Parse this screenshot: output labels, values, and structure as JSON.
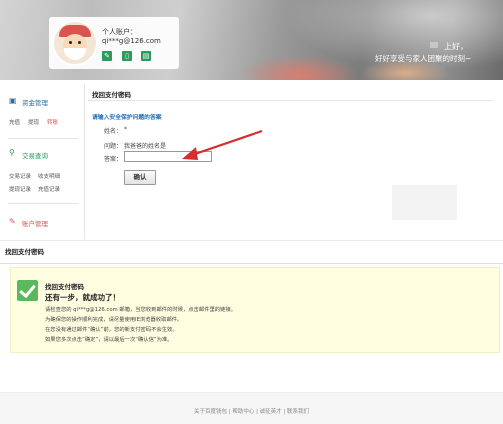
{
  "header": {
    "account_label": "个人账户：",
    "account_email": "qi***g@126.com",
    "greeting_line1": "上好，",
    "greeting_line2": "好好享受与家人团聚的时刻~"
  },
  "sidebar": {
    "fund": {
      "title": "资金管理",
      "links": [
        "充值",
        "提现",
        "转账"
      ]
    },
    "trade": {
      "title": "交易查询",
      "links": [
        "交易记录",
        "收支明细",
        "提现记录",
        "充值记录"
      ]
    },
    "account": {
      "title": "账户管理"
    }
  },
  "main": {
    "title": "找回支付密码",
    "subtitle": "请输入安全保护问题的答案",
    "name_label": "姓名：",
    "name_value": "*",
    "question_label": "问题：",
    "question_value": "我爸爸的姓名是",
    "answer_label": "答案：",
    "answer_value": "",
    "confirm_label": "确认"
  },
  "result": {
    "section_title": "找回支付密码",
    "box_title": "找回支付密码",
    "headline": "还有一步，就成功了！",
    "lines": [
      "请检查您的 qi***g@126.com 邮箱，当您收到邮件的时候，点击邮件里的链接。",
      "为确保您的操作顺利完成，请尽量使用IE浏览器收取邮件。",
      "在您没有通过邮件“确认”前，您的新支付密码不会生效。",
      "如果您多次点击“确定”，请以最后一次“确认信”为准。"
    ]
  },
  "footer": {
    "text": "关于百度钱包 | 帮助中心 | 诚征英才 | 联系我们"
  },
  "colors": {
    "link_blue": "#2e6da4",
    "accent_red": "#d9534f",
    "icon_green": "#2c9a5a",
    "notice_bg": "#fffde0"
  }
}
